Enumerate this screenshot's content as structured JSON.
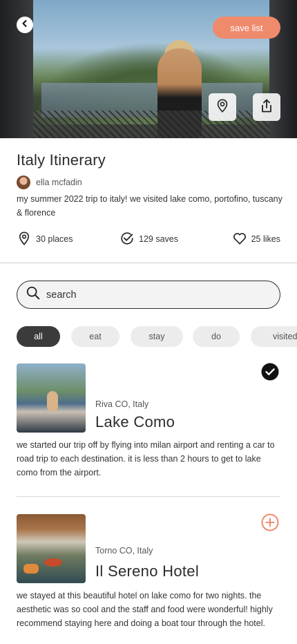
{
  "header": {
    "save_label": "save list"
  },
  "itinerary": {
    "title": "Italy Itinerary",
    "author": "ella mcfadin",
    "description": "my summer 2022 trip to italy! we visited lake como, portofino, tuscany & florence"
  },
  "stats": {
    "places": "30 places",
    "saves": "129 saves",
    "likes": "25 likes"
  },
  "search": {
    "placeholder": "search"
  },
  "filters": [
    {
      "label": "all",
      "active": true
    },
    {
      "label": "eat",
      "active": false
    },
    {
      "label": "stay",
      "active": false
    },
    {
      "label": "do",
      "active": false
    },
    {
      "label": "visited",
      "active": false
    }
  ],
  "places": [
    {
      "location": "Riva CO, Italy",
      "name": "Lake Como",
      "description": "we started our trip off by flying into milan airport and renting a car to road trip to each destination. it is less than 2 hours to get to lake como from the airport.",
      "status": "visited"
    },
    {
      "location": "Torno CO, Italy",
      "name": "Il Sereno Hotel",
      "description": "we stayed at this beautiful hotel on lake como for two nights. the aesthetic was so cool and the staff and food were wonderful! highly recommend staying here and doing a boat tour through the hotel.",
      "status": "add"
    }
  ],
  "colors": {
    "accent": "#f08a6c",
    "active_chip": "#3b3b3b",
    "add_icon": "#f08a6c"
  }
}
